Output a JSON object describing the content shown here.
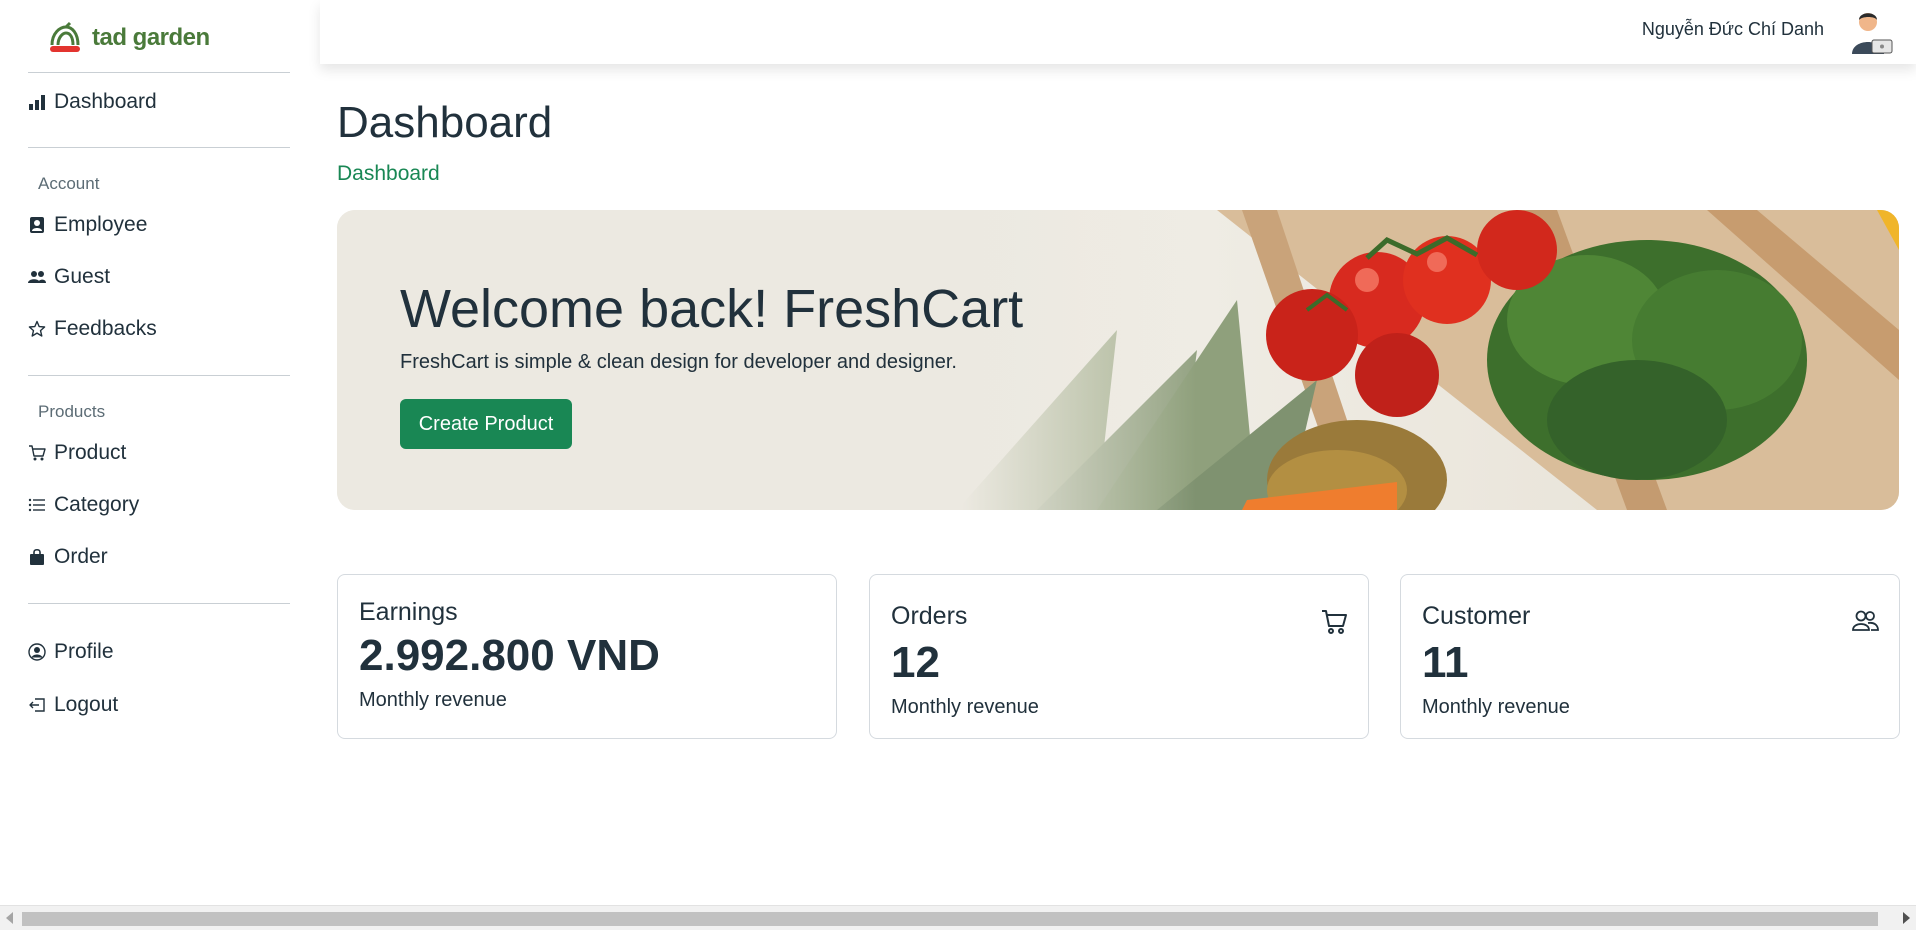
{
  "brand": {
    "name": "tad garden",
    "color": "#4a7a3a"
  },
  "sidebar": {
    "items_top": [
      {
        "label": "Dashboard",
        "icon": "bar-chart-icon"
      }
    ],
    "account_heading": "Account",
    "account_items": [
      {
        "label": "Employee",
        "icon": "person-badge-icon"
      },
      {
        "label": "Guest",
        "icon": "people-icon"
      },
      {
        "label": "Feedbacks",
        "icon": "star-icon"
      }
    ],
    "products_heading": "Products",
    "products_items": [
      {
        "label": "Product",
        "icon": "cart-icon"
      },
      {
        "label": "Category",
        "icon": "list-icon"
      },
      {
        "label": "Order",
        "icon": "bag-icon"
      }
    ],
    "bottom_items": [
      {
        "label": "Profile",
        "icon": "person-circle-icon"
      },
      {
        "label": "Logout",
        "icon": "logout-icon"
      }
    ]
  },
  "topbar": {
    "user_name": "Nguyễn Đức Chí Danh"
  },
  "main": {
    "title": "Dashboard",
    "breadcrumb": "Dashboard",
    "banner": {
      "heading": "Welcome back! FreshCart",
      "subtitle": "FreshCart is simple & clean design for developer and designer.",
      "button": "Create Product"
    },
    "cards": [
      {
        "title": "Earnings",
        "value": "2.992.800 VND",
        "subtitle": "Monthly revenue",
        "icon": ""
      },
      {
        "title": "Orders",
        "value": "12",
        "subtitle": "Monthly revenue",
        "icon": "cart-icon"
      },
      {
        "title": "Customer",
        "value": "11",
        "subtitle": "Monthly revenue",
        "icon": "people-icon"
      }
    ]
  },
  "colors": {
    "accent": "#198754",
    "text": "#21313c",
    "muted": "#5c6c75"
  }
}
